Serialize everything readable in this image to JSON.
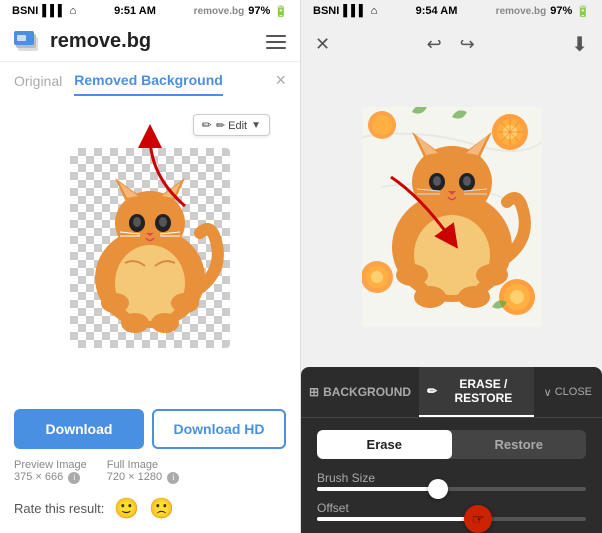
{
  "left": {
    "statusBar": {
      "carrier": "BSNI",
      "time": "9:51 AM",
      "battery": "97%",
      "url": "remove.bg"
    },
    "header": {
      "logoText": "remove.bg"
    },
    "tabs": {
      "original": "Original",
      "removedBg": "Removed Background"
    },
    "editButton": "✏ Edit",
    "actionButtons": {
      "download": "Download",
      "downloadHD": "Download HD"
    },
    "imageInfo": {
      "preview": "Preview Image",
      "previewSize": "375 × 666",
      "full": "Full Image",
      "fullSize": "720 × 1280"
    },
    "rateLabel": "Rate this result:"
  },
  "right": {
    "statusBar": {
      "carrier": "BSNI",
      "time": "9:54 AM",
      "battery": "97%",
      "url": "remove.bg"
    },
    "toolbarTabs": {
      "background": "BACKGROUND",
      "eraseRestore": "ERASE / RESTORE",
      "close": "CLOSE"
    },
    "panel": {
      "eraseLabel": "Erase",
      "restoreLabel": "Restore",
      "brushSizeLabel": "Brush Size",
      "offsetLabel": "Offset"
    }
  }
}
